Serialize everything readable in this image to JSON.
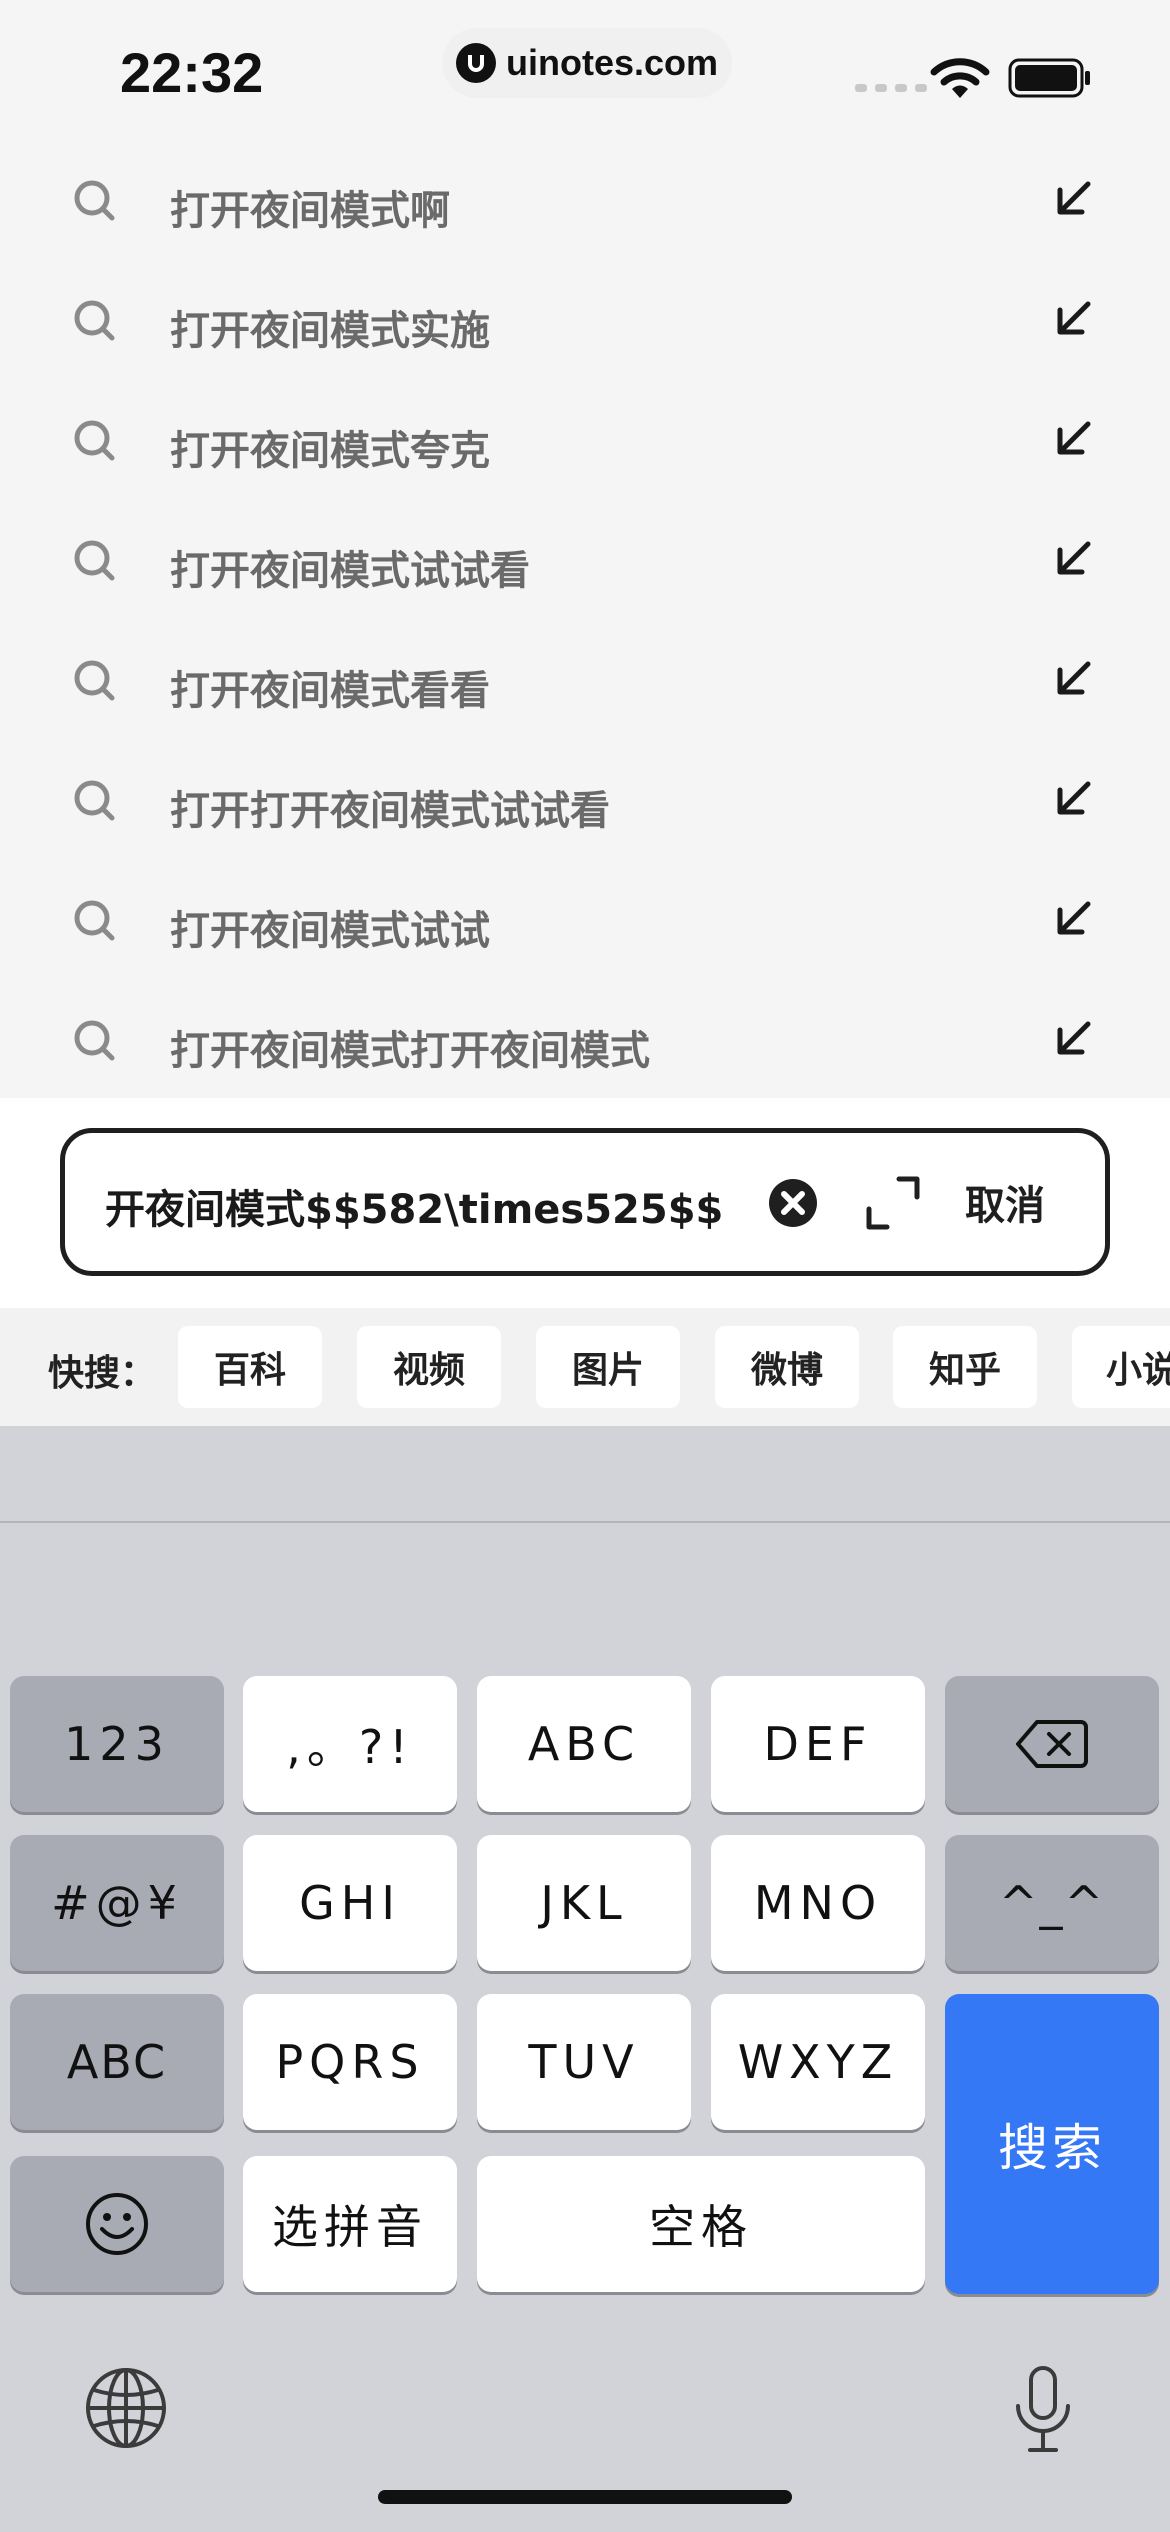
{
  "status_bar": {
    "time": "22:32",
    "url": "uinotes.com",
    "icons": [
      "signal-icon",
      "wifi-icon",
      "battery-icon"
    ]
  },
  "suggestions": [
    {
      "text": "打开夜间模式啊"
    },
    {
      "text": "打开夜间模式实施"
    },
    {
      "text": "打开夜间模式夸克"
    },
    {
      "text": "打开夜间模式试试看"
    },
    {
      "text": "打开夜间模式看看"
    },
    {
      "text": "打开打开夜间模式试试看"
    },
    {
      "text": "打开夜间模式试试"
    },
    {
      "text": "打开夜间模式打开夜间模式"
    }
  ],
  "search": {
    "value": "开夜间模式$$582\\times525$$",
    "cancel_label": "取消"
  },
  "quick_search": {
    "label": "快搜：",
    "chips": [
      "百科",
      "视频",
      "图片",
      "微博",
      "知乎",
      "小说"
    ]
  },
  "keyboard": {
    "keys": {
      "numbers": "123",
      "punct": ",。?!",
      "abc_key": "ABC",
      "def_key": "DEF",
      "symbols": "#@¥",
      "ghi": "GHI",
      "jkl": "JKL",
      "mno": "MNO",
      "emoticon": "^_^",
      "abc_mode": "ABC",
      "pqrs": "PQRS",
      "tuv": "TUV",
      "wxyz": "WXYZ",
      "search": "搜索",
      "pinyin": "选拼音",
      "space": "空格"
    }
  },
  "colors": {
    "accent": "#3478f6",
    "keyboard_bg": "#d1d3d9",
    "dark_key": "#a8abb4"
  }
}
